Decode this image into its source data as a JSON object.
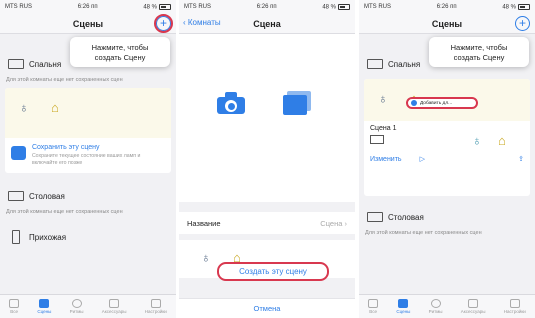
{
  "status": {
    "carrier": "MTS RUS",
    "time": "6:26 пп",
    "battery": "48 %"
  },
  "screen1": {
    "title": "Сцены",
    "tooltip": "Нажмите, чтобы создать Сцену",
    "room1": "Спальня",
    "note": "Для этой комнаты еще нет сохраненных сцен",
    "save_title": "Сохранить эту сцену",
    "save_desc": "Сохраните текущее состояние ваших ламп и включайте его позже",
    "room2": "Столовая",
    "room3": "Прихожая"
  },
  "screen2": {
    "back": "Комнаты",
    "title": "Сцена",
    "name_label": "Название",
    "name_value": "Сцена",
    "create_button": "Создать эту сцену",
    "cancel": "Отмена"
  },
  "screen3": {
    "title": "Сцены",
    "tooltip": "Нажмите, чтобы создать Сцену",
    "room1": "Спальня",
    "scene_name": "Сцена 1",
    "edit": "Изменить",
    "toast": "Добавить дл...",
    "room2": "Столовая",
    "note": "Для этой комнаты еще нет сохраненных сцен"
  },
  "tabs": [
    "Все",
    "Сцены",
    "Ритмы",
    "Аксессуары",
    "Настройки"
  ],
  "colors": {
    "accent": "#2f7ee6",
    "highlight": "#d8384f"
  }
}
